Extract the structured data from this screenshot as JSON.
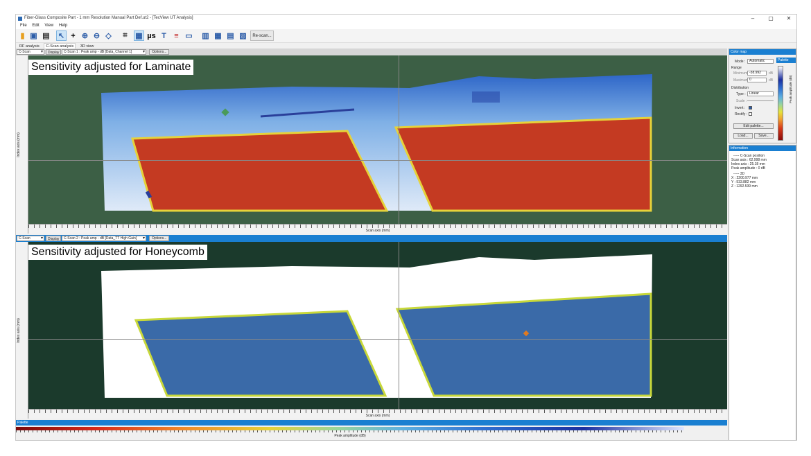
{
  "window": {
    "title": "Fiber-Glass Composite Part - 1 mm Resolution Manual Part Def.ut2 - [TecView UT Analysis]",
    "minimize": "–",
    "maximize": "▢",
    "close": "✕"
  },
  "menu": [
    "File",
    "Edit",
    "View",
    "Help"
  ],
  "toolbar": {
    "us_label": "µs",
    "rescan_label": "Re-scan..."
  },
  "tabs": [
    "RF analysis",
    "C-Scan analysis",
    "3D view"
  ],
  "cscan1": {
    "mode": "C-Scan",
    "display_label": "Display",
    "display_value": "C-Scan 1 : Peak amp - dB [Data_Channel 1]",
    "options_label": "Options...",
    "banner": "Sensitivity adjusted for Laminate",
    "yaxis_label": "Index axis (mm)",
    "xaxis_label": "Scan axis (mm)"
  },
  "cscan2": {
    "mode": "C-Scan",
    "display_label": "Display",
    "display_value": "C-Scan 2 : Peak amp - dB [Data_TT High Gain]",
    "options_label": "Options...",
    "banner": "Sensitivity adjusted for Honeycomb",
    "yaxis_label": "Index axis (mm)",
    "xaxis_label": "Scan axis (mm)"
  },
  "colormap": {
    "header": "Color map",
    "palette_tab": "Palette",
    "mode_label": "Mode :",
    "mode_value": "Automatic",
    "range_label": "Range",
    "minimum_label": "Minimum :",
    "minimum_value": "-38.992",
    "maximum_label": "Maximum :",
    "maximum_value": "0",
    "unit": "dB",
    "distribution_label": "Distribution",
    "type_label": "Type :",
    "type_value": "Linear",
    "scale_label": "Scale :",
    "invert_label": "Invert :",
    "rectify_label": "Rectify :",
    "edit_palette": "Edit palette...",
    "load": "Load...",
    "save": "Save...",
    "palette_axis": "Peak amplitude (dB)"
  },
  "information": {
    "header": "Information",
    "section_cscan": "----- C-Scan position",
    "scan_axis": "Scan axis : 62.998 mm",
    "index_axis": "Index axis : 25.18 mm",
    "peak_amplitude": "Peak amplitude : 0 dB",
    "section_3d": "----- 3D",
    "x": "X : 2200.977 mm",
    "y": "Y : 533.882 mm",
    "z": "Z : 1292.539 mm"
  },
  "palette_bar": {
    "header": "Palette",
    "axis_label": "Peak amplitude (dB)"
  }
}
